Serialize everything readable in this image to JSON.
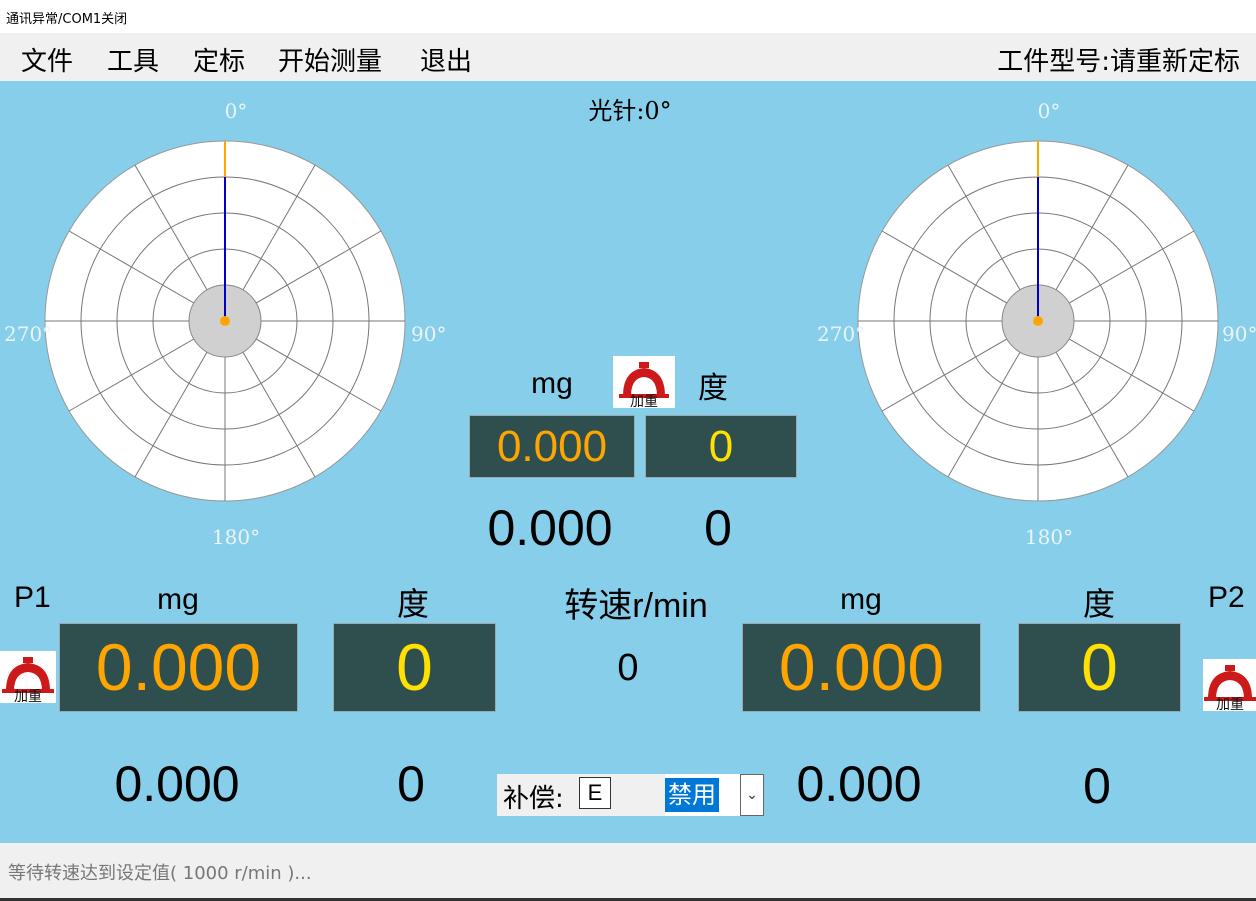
{
  "window": {
    "title": "通讯异常/COM1关闭"
  },
  "menu": {
    "items": [
      "文件",
      "工具",
      "定标",
      "开始测量",
      "退出"
    ],
    "model_label": "工件型号:请重新定标"
  },
  "polar": {
    "angles": [
      "0°",
      "90°",
      "180°",
      "270°"
    ],
    "pointer_label": "光针:0°"
  },
  "center": {
    "mg_header": "mg",
    "deg_header": "度",
    "weight_icon_text": "加重",
    "mg_value": "0.000",
    "deg_value": "0",
    "mg_sub": "0.000",
    "deg_sub": "0"
  },
  "p1": {
    "label": "P1",
    "mg_header": "mg",
    "deg_header": "度",
    "weight_icon_text": "加重",
    "mg_value": "0.000",
    "deg_value": "0",
    "mg_sub": "0.000",
    "deg_sub": "0"
  },
  "p2": {
    "label": "P2",
    "mg_header": "mg",
    "deg_header": "度",
    "weight_icon_text": "加重",
    "mg_value": "0.000",
    "deg_value": "0",
    "mg_sub": "0.000",
    "deg_sub": "0"
  },
  "speed": {
    "label": "转速r/min",
    "value": "0"
  },
  "compensation": {
    "label": "补偿:",
    "input_value": "E",
    "select_value": "禁用"
  },
  "status": {
    "message": "等待转速达到设定值( 1000 r/min )..."
  },
  "colors": {
    "background": "#87ceeb",
    "display_bg": "#2f4f4f",
    "mg_text": "#ffa500",
    "deg_text": "#ffe000",
    "needle": "#0000cc",
    "needle_tip": "#ffa500",
    "weight_icon": "#cc1a1a"
  }
}
